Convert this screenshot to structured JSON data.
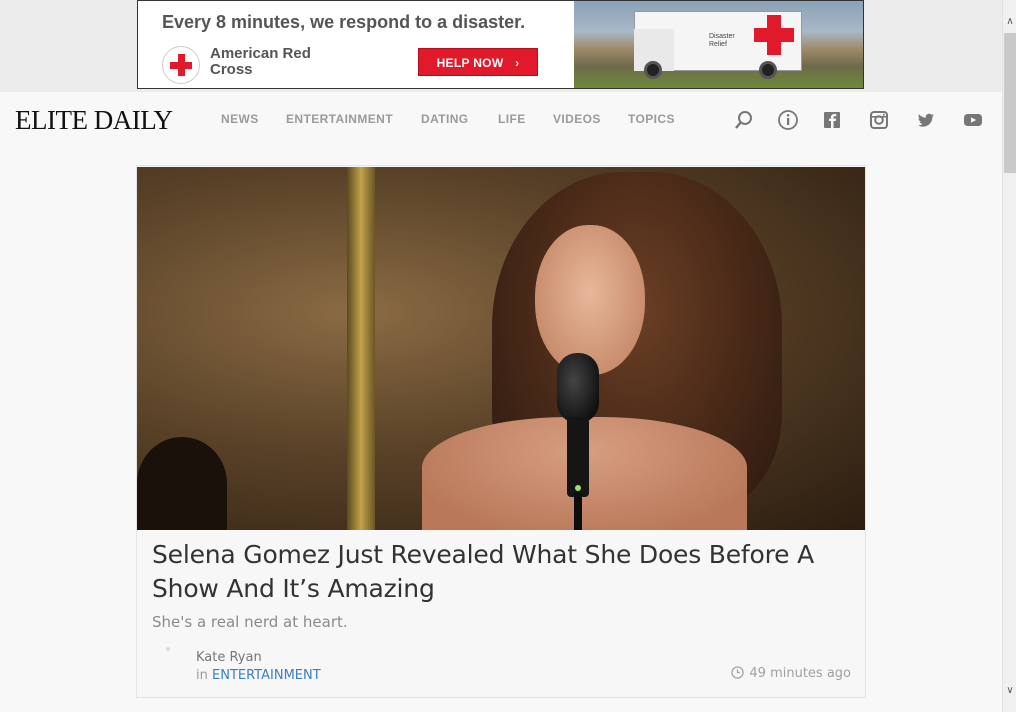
{
  "ad": {
    "headline": "Every 8 minutes, we respond to a disaster.",
    "brand": "American Red Cross",
    "cta": "HELP NOW",
    "cta_arrow": "›",
    "truck_label": "Disaster Relief"
  },
  "header": {
    "logo": "ELITE DAILY",
    "nav": [
      {
        "label": "NEWS"
      },
      {
        "label": "ENTERTAINMENT"
      },
      {
        "label": "DATING"
      },
      {
        "label": "LIFE"
      },
      {
        "label": "VIDEOS"
      },
      {
        "label": "TOPICS"
      }
    ],
    "icons": [
      "search-icon",
      "info-icon",
      "facebook-icon",
      "instagram-icon",
      "twitter-icon",
      "youtube-icon"
    ]
  },
  "article": {
    "title": "Selena Gomez Just Revealed What She Does Before A Show And It’s Amazing",
    "subtitle": "She's a real nerd at heart.",
    "author": "Kate Ryan",
    "in_prefix": "in",
    "category": "ENTERTAINMENT",
    "time": "49 minutes ago"
  },
  "colors": {
    "accent": "#3a7fc1",
    "redcross": "#e11a2b",
    "nav_text": "#9a9a9a"
  }
}
